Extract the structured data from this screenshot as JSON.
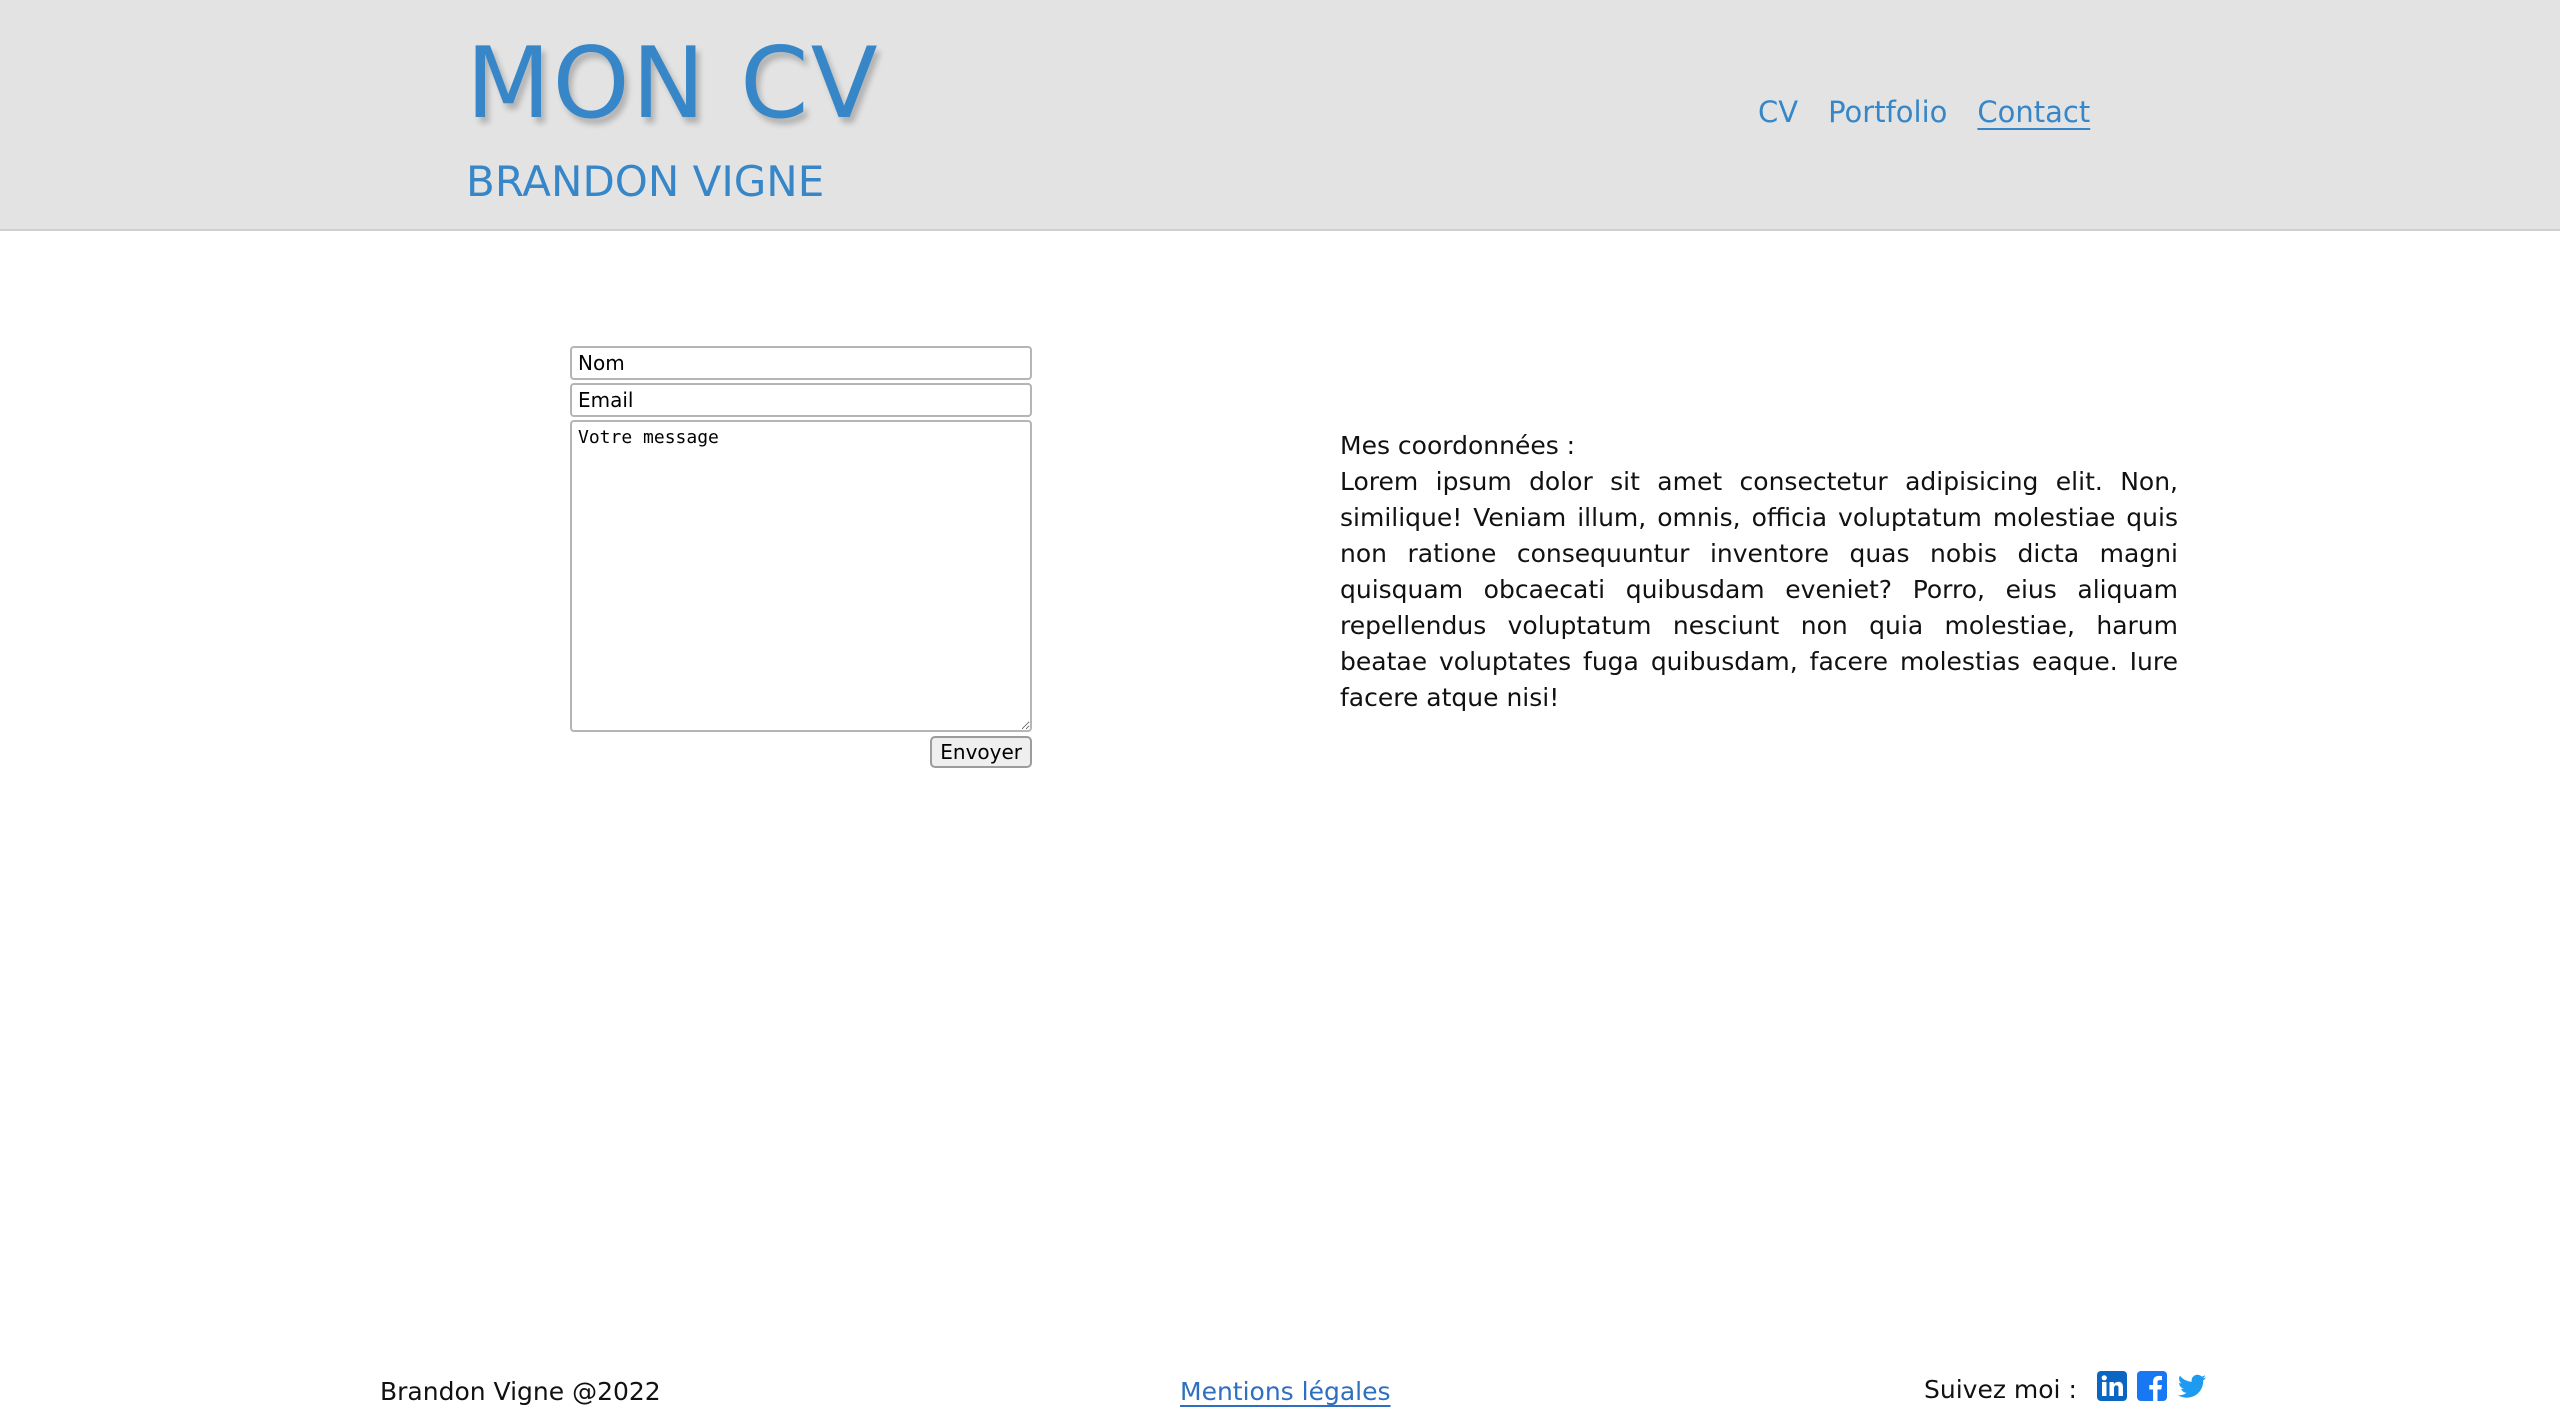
{
  "header": {
    "title": "MON CV",
    "subtitle": "BRANDON VIGNE",
    "nav": [
      {
        "label": "CV",
        "active": false
      },
      {
        "label": "Portfolio",
        "active": false
      },
      {
        "label": "Contact",
        "active": true
      }
    ]
  },
  "form": {
    "name_placeholder": "Nom",
    "email_placeholder": "Email",
    "message_placeholder": "Votre message",
    "submit_label": "Envoyer"
  },
  "info": {
    "heading": "Mes coordonnées :",
    "body": "Lorem ipsum dolor sit amet consectetur adipisicing elit. Non, similique! Veniam illum, omnis, officia voluptatum molestiae quis non ratione consequuntur inventore quas nobis dicta magni quisquam obcaecati quibusdam eveniet? Porro, eius aliquam repellendus voluptatum nesciunt non quia molestiae, harum beatae voluptates fuga quibusdam, facere molestias eaque. Iure facere atque nisi!"
  },
  "footer": {
    "copyright": "Brandon Vigne @2022",
    "legal_link": "Mentions légales",
    "follow_label": "Suivez moi :",
    "social_icons": [
      "linkedin-icon",
      "facebook-icon",
      "twitter-icon"
    ]
  },
  "colors": {
    "accent": "#3787c8",
    "header_bg": "#e3e3e3",
    "link": "#2e6fc0",
    "linkedin": "#0a66c2",
    "facebook": "#1877f2",
    "twitter": "#1d9bf0"
  }
}
